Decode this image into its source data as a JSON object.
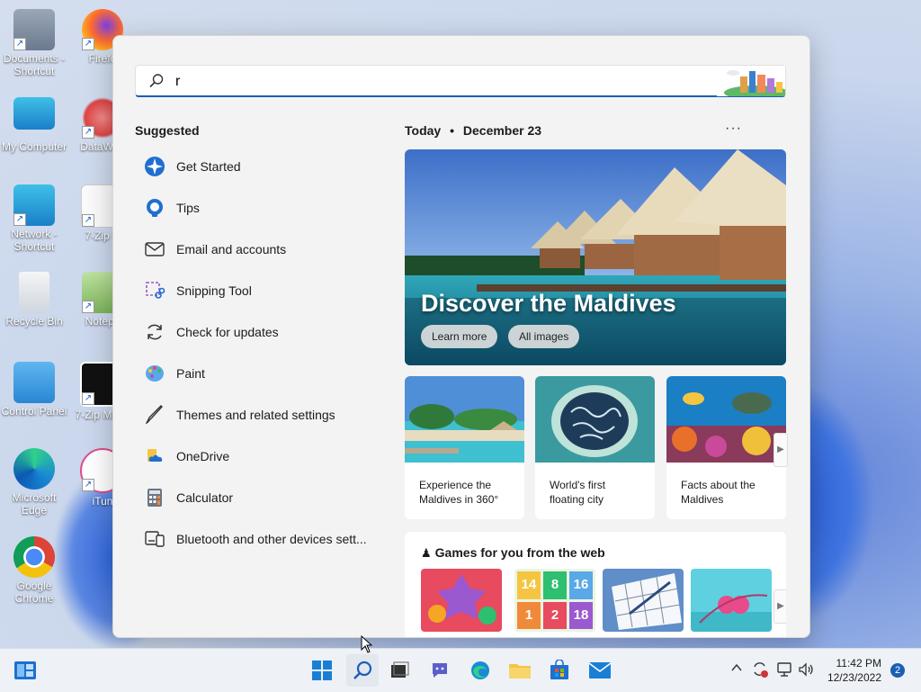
{
  "desktop": {
    "icons": [
      {
        "label": "Documents - Shortcut"
      },
      {
        "label": "Firefo"
      },
      {
        "label": "My Computer"
      },
      {
        "label": "DataWag"
      },
      {
        "label": "Network - Shortcut"
      },
      {
        "label": "7-Zip H"
      },
      {
        "label": "Recycle Bin"
      },
      {
        "label": "Notepa"
      },
      {
        "label": "Control Panel"
      },
      {
        "label": "7-Zip Mana"
      },
      {
        "label": "Microsoft Edge"
      },
      {
        "label": "iTun"
      },
      {
        "label": "Google Chrome"
      }
    ]
  },
  "search": {
    "query": "r"
  },
  "suggested": {
    "title": "Suggested",
    "items": [
      {
        "label": "Get Started",
        "icon": "get-started-icon"
      },
      {
        "label": "Tips",
        "icon": "tips-icon"
      },
      {
        "label": "Email and accounts",
        "icon": "mail-icon"
      },
      {
        "label": "Snipping Tool",
        "icon": "snipping-tool-icon"
      },
      {
        "label": "Check for updates",
        "icon": "sync-icon"
      },
      {
        "label": "Paint",
        "icon": "paint-icon"
      },
      {
        "label": "Themes and related settings",
        "icon": "brush-icon"
      },
      {
        "label": "OneDrive",
        "icon": "onedrive-icon"
      },
      {
        "label": "Calculator",
        "icon": "calculator-icon"
      },
      {
        "label": "Bluetooth and other devices sett...",
        "icon": "devices-icon"
      }
    ]
  },
  "today": {
    "label": "Today",
    "separator": "•",
    "date": "December 23",
    "more": "···"
  },
  "hero": {
    "title": "Discover the Maldives",
    "learn_more": "Learn more",
    "all_images": "All images"
  },
  "cards": [
    {
      "caption": "Experience the Maldives in 360°"
    },
    {
      "caption": "World's first floating city"
    },
    {
      "caption": "Facts about the Maldives"
    }
  ],
  "games": {
    "title": "Games for you from the web",
    "tiles": [
      "14",
      "8",
      "16",
      "1",
      "2",
      "18"
    ]
  },
  "taskbar": {
    "time": "11:42 PM",
    "date": "12/23/2022",
    "notifications": "2"
  },
  "colors": {
    "accent": "#1a5fb4",
    "panel_bg": "#f3f3f3"
  }
}
